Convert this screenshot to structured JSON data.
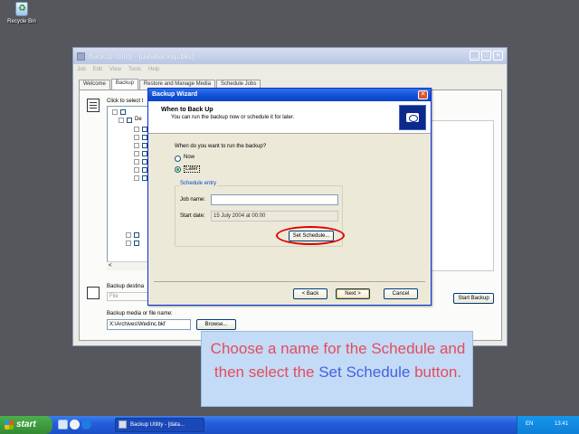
{
  "desktop": {
    "recycle_bin_label": "Recycle Bin"
  },
  "main_window": {
    "title": "Backup Utility - [databackup.bks]",
    "menu": [
      "Job",
      "Edit",
      "View",
      "Tools",
      "Help"
    ],
    "tabs": [
      "Welcome",
      "Backup",
      "Restore and Manage Media",
      "Schedule Jobs"
    ],
    "active_tab": "Backup",
    "click_to_select_label": "Click to select t",
    "backup_destination_label": "Backup destina",
    "backup_destination_value": "File",
    "backup_media_label": "Backup media or file name:",
    "backup_media_value": "X:\\Archives\\Wedinc.bkf",
    "browse_button": "Browse...",
    "start_backup_button": "Start Backup",
    "tree_node_label": "De"
  },
  "wizard": {
    "title": "Backup Wizard",
    "close_glyph": "✕",
    "heading": "When to Back Up",
    "subheading": "You can run the backup now or schedule it for later.",
    "question": "When do you want to run the backup?",
    "option_now": "Now",
    "option_later": "Later",
    "selected_option": "Later",
    "schedule_group_label": "Schedule entry",
    "job_name_label": "Job name:",
    "job_name_value": "",
    "start_date_label": "Start date:",
    "start_date_value": "15 July 2004 at 00:00",
    "set_schedule_button": "Set Schedule...",
    "back_button": "< Back",
    "next_button": "Next >",
    "cancel_button": "Cancel"
  },
  "instruction": {
    "part1": "Choose a name for the Schedule and then select the ",
    "highlight": "Set Schedule",
    "part2": " button."
  },
  "taskbar": {
    "start_label": "start",
    "task_button": "Backup Utility - [data...",
    "language": "EN",
    "clock": "13:41"
  },
  "colors": {
    "highlight_ring": "#e00000",
    "instruction_text": "#e34c5e",
    "instruction_highlight": "#4463e0",
    "instruction_bg": "#c3dbf6"
  }
}
